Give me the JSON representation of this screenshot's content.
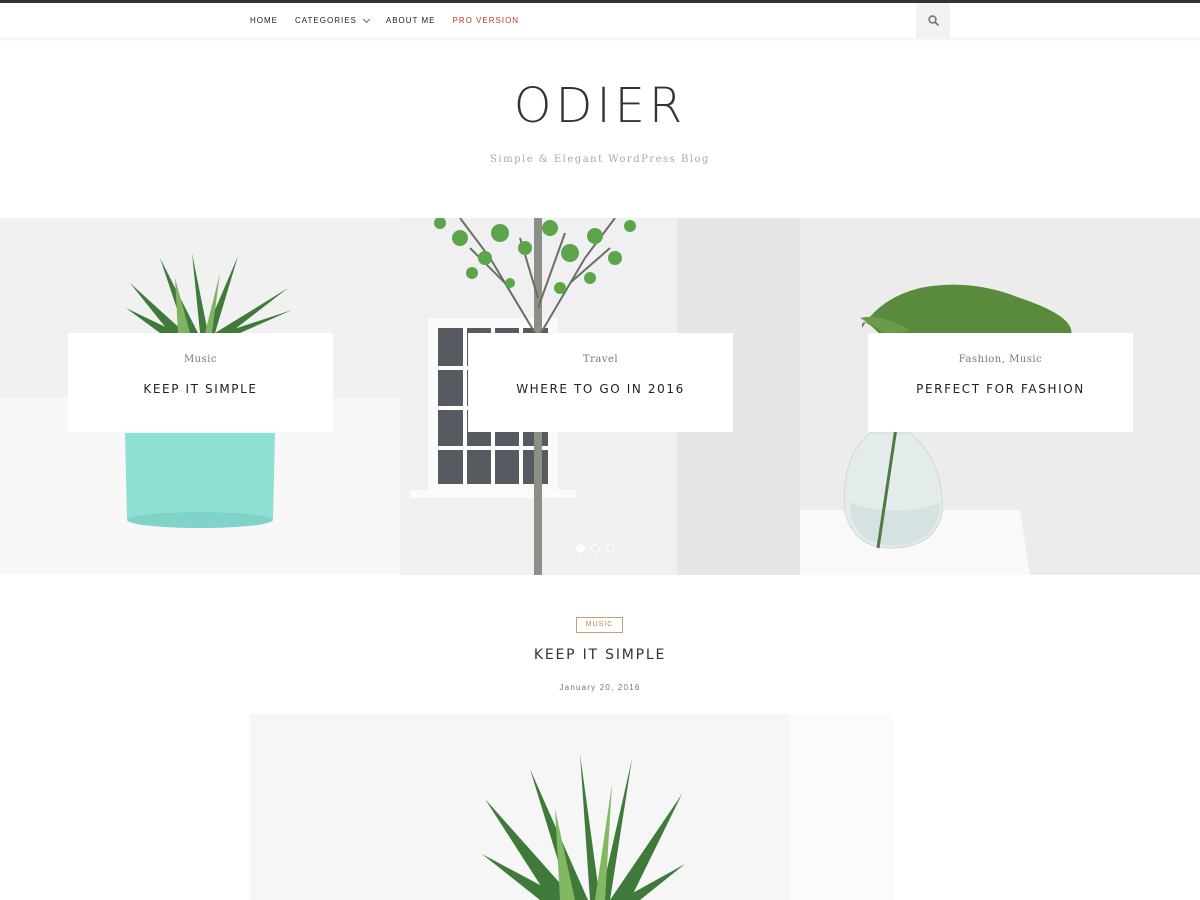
{
  "nav": {
    "items": [
      {
        "label": "HOME"
      },
      {
        "label": "CATEGORIES"
      },
      {
        "label": "ABOUT ME"
      },
      {
        "label": "PRO VERSION"
      }
    ],
    "search_icon": "search-icon"
  },
  "brand": {
    "title": "ODIER",
    "description": "Simple & Elegant WordPress Blog"
  },
  "slider": {
    "slides": [
      {
        "category": "Music",
        "title": "KEEP IT SIMPLE"
      },
      {
        "category": "Travel",
        "title": "WHERE TO GO IN 2016"
      },
      {
        "category": "Fashion, Music",
        "title": "PERFECT FOR FASHION"
      }
    ],
    "dots": 3,
    "active_dot": 1
  },
  "post": {
    "category": "MUSIC",
    "title": "KEEP IT SIMPLE",
    "date": "January 20, 2016"
  },
  "colors": {
    "accent_pro": "#c0392b",
    "category_badge": "#b78a4b",
    "pot": "#86e0d6"
  }
}
